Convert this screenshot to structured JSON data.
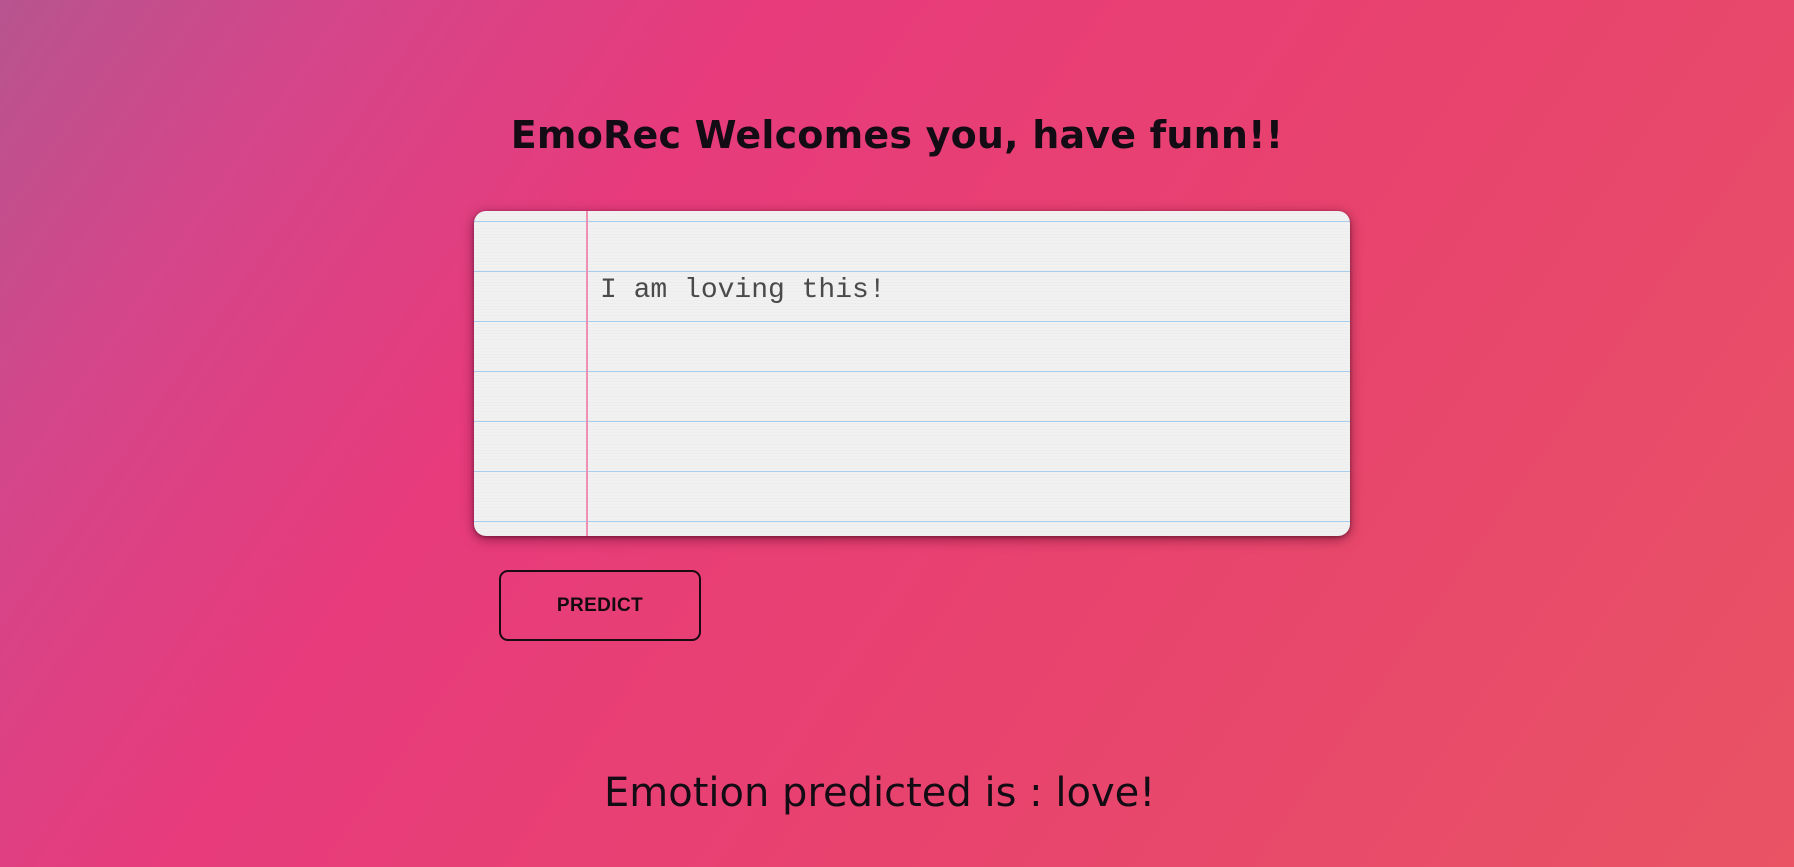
{
  "header": {
    "title": "EmoRec Welcomes you, have funn!!"
  },
  "input": {
    "value": "I am loving this!"
  },
  "actions": {
    "predict_label": "PREDICT"
  },
  "result": {
    "text": "Emotion predicted is : love!"
  },
  "colors": {
    "gradient_start": "#b7548f",
    "gradient_mid": "#e73b7c",
    "gradient_end": "#e95364",
    "paper": "#f1f1f1",
    "ruled_line": "#a9cdee",
    "margin_line": "#ee8fb4",
    "text_dark": "#140c14"
  }
}
